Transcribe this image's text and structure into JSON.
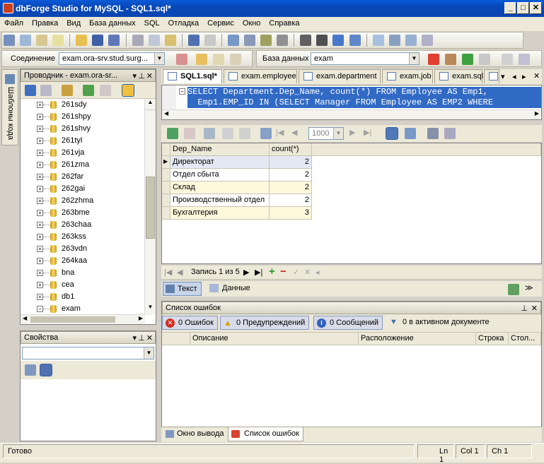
{
  "window": {
    "title": "dbForge Studio for MySQL - SQL1.sql*"
  },
  "menu": [
    "Файл",
    "Правка",
    "Вид",
    "База данных",
    "SQL",
    "Отладка",
    "Сервис",
    "Окно",
    "Справка"
  ],
  "conn_bar": {
    "label": "Соединение",
    "value": "exam.ora-srv.stud.surg...",
    "db_label": "База данных",
    "db_value": "exam"
  },
  "side_tab": "Шаблоны кода",
  "explorer": {
    "title": "Проводник - exam.ora-sr...",
    "items": [
      "261sdy",
      "261shpy",
      "261shvy",
      "261tyl",
      "261vja",
      "261zma",
      "262far",
      "262gai",
      "262zhma",
      "263bme",
      "263chaa",
      "263kss",
      "263vdn",
      "264kaa",
      "bna",
      "cea",
      "db1",
      "exam"
    ]
  },
  "props": {
    "title": "Свойства"
  },
  "tabs": [
    "SQL1.sql*",
    "exam.employee",
    "exam.department",
    "exam.job",
    "exam.sql"
  ],
  "editor": {
    "line1": "SELECT Department.Dep_Name, count(*) FROM Employee AS Emp1,",
    "line2": "  Emp1.EMP_ID IN (SELECT Manager FROM Employee AS EMP2 WHERE"
  },
  "grid_toolbar": {
    "page_size": "1000"
  },
  "grid": {
    "columns": [
      "Dep_Name",
      "count(*)"
    ],
    "rows": [
      [
        "Директорат",
        "2"
      ],
      [
        "Отдел сбыта",
        "2"
      ],
      [
        "Склад",
        "2"
      ],
      [
        "Производственный отдел",
        "2"
      ],
      [
        "Бухгалтерия",
        "3"
      ]
    ]
  },
  "nav": {
    "record": "Запись 1 из 5"
  },
  "view_tabs": {
    "text": "Текст",
    "data": "Данные"
  },
  "errors": {
    "title": "Список ошибок",
    "errors": "0 Ошибок",
    "warnings": "0 Предупреждений",
    "messages": "0 Сообщений",
    "filter": "0 в активном документе",
    "cols": [
      "Описание",
      "Расположение",
      "Строка",
      "Стол..."
    ]
  },
  "bottom_tabs": {
    "output": "Окно вывода",
    "errors": "Список ошибок"
  },
  "status": {
    "ready": "Готово",
    "ln": "Ln 1",
    "col": "Col 1",
    "ch": "Ch 1"
  }
}
